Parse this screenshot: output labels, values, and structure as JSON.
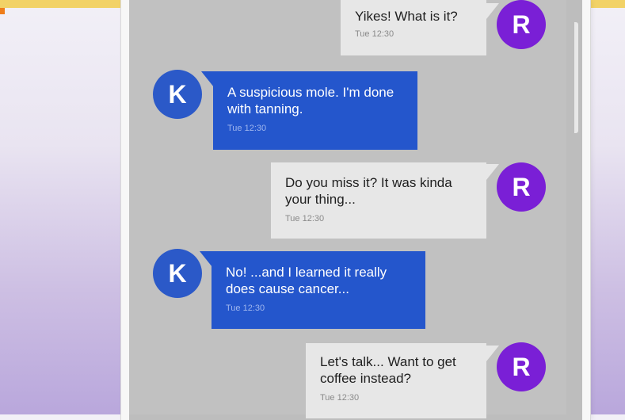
{
  "conversation": {
    "messages": [
      {
        "sender": "R",
        "direction": "outgoing",
        "text": "Yikes! What is it?",
        "time": "Tue 12:30"
      },
      {
        "sender": "K",
        "direction": "incoming",
        "text": "A suspicious mole. I'm done with tanning.",
        "time": "Tue 12:30"
      },
      {
        "sender": "R",
        "direction": "outgoing",
        "text": "Do you miss it? It was kinda your thing...",
        "time": "Tue 12:30"
      },
      {
        "sender": "K",
        "direction": "incoming",
        "text": "No! ...and I learned it really does cause cancer...",
        "time": "Tue 12:30"
      },
      {
        "sender": "R",
        "direction": "outgoing",
        "text": "Let's talk... Want to get coffee instead?",
        "time": "Tue 12:30"
      }
    ]
  },
  "colors": {
    "incoming_bubble": "#2456cc",
    "outgoing_bubble": "#e7e7e7",
    "avatar_k": "#2b59c8",
    "avatar_r": "#7a1fd6"
  }
}
